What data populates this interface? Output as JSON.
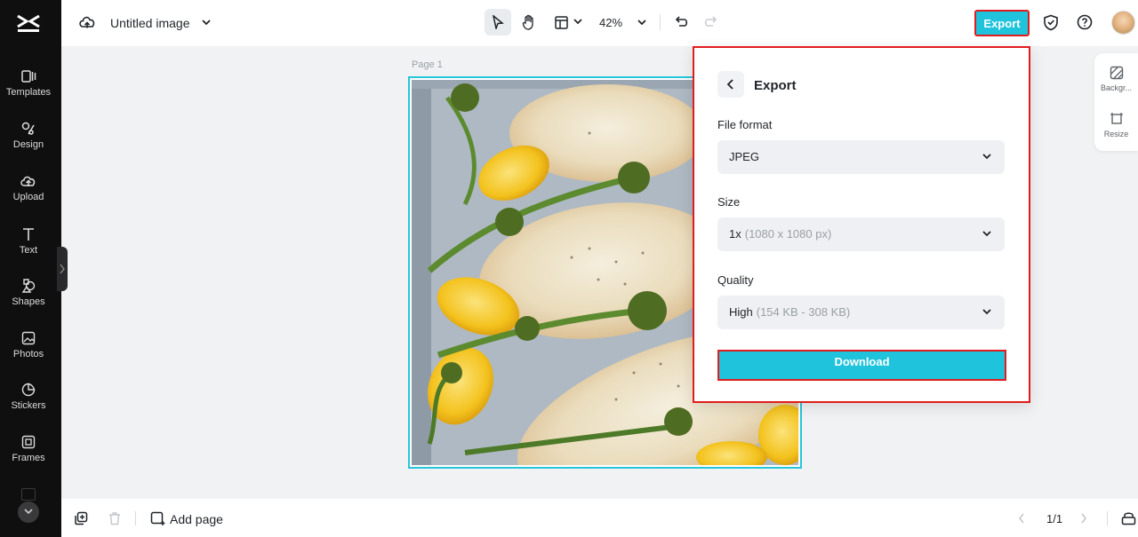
{
  "sidebar": {
    "logo": "capcut-logo",
    "items": [
      {
        "label": "Templates",
        "icon": "templates-icon"
      },
      {
        "label": "Design",
        "icon": "design-icon"
      },
      {
        "label": "Upload",
        "icon": "upload-icon"
      },
      {
        "label": "Text",
        "icon": "text-icon"
      },
      {
        "label": "Shapes",
        "icon": "shapes-icon"
      },
      {
        "label": "Photos",
        "icon": "photos-icon"
      },
      {
        "label": "Stickers",
        "icon": "stickers-icon"
      },
      {
        "label": "Frames",
        "icon": "frames-icon"
      }
    ]
  },
  "topbar": {
    "title": "Untitled image",
    "zoom": "42%",
    "export_label": "Export"
  },
  "canvas": {
    "page_label": "Page 1",
    "image": "food-photo"
  },
  "right_panel": {
    "items": [
      {
        "label": "Backgr...",
        "icon": "background-icon"
      },
      {
        "label": "Resize",
        "icon": "resize-icon"
      }
    ]
  },
  "export_panel": {
    "title": "Export",
    "file_format": {
      "label": "File format",
      "value": "JPEG"
    },
    "size": {
      "label": "Size",
      "value": "1x",
      "detail": "(1080 x 1080 px)"
    },
    "quality": {
      "label": "Quality",
      "value": "High",
      "detail": "(154 KB - 308 KB)"
    },
    "download_label": "Download"
  },
  "bottombar": {
    "add_page_label": "Add page",
    "pages": "1/1"
  },
  "colors": {
    "accent": "#1fc3dc",
    "highlight": "#e11c1c",
    "sidebar_bg": "#0f0f10"
  }
}
